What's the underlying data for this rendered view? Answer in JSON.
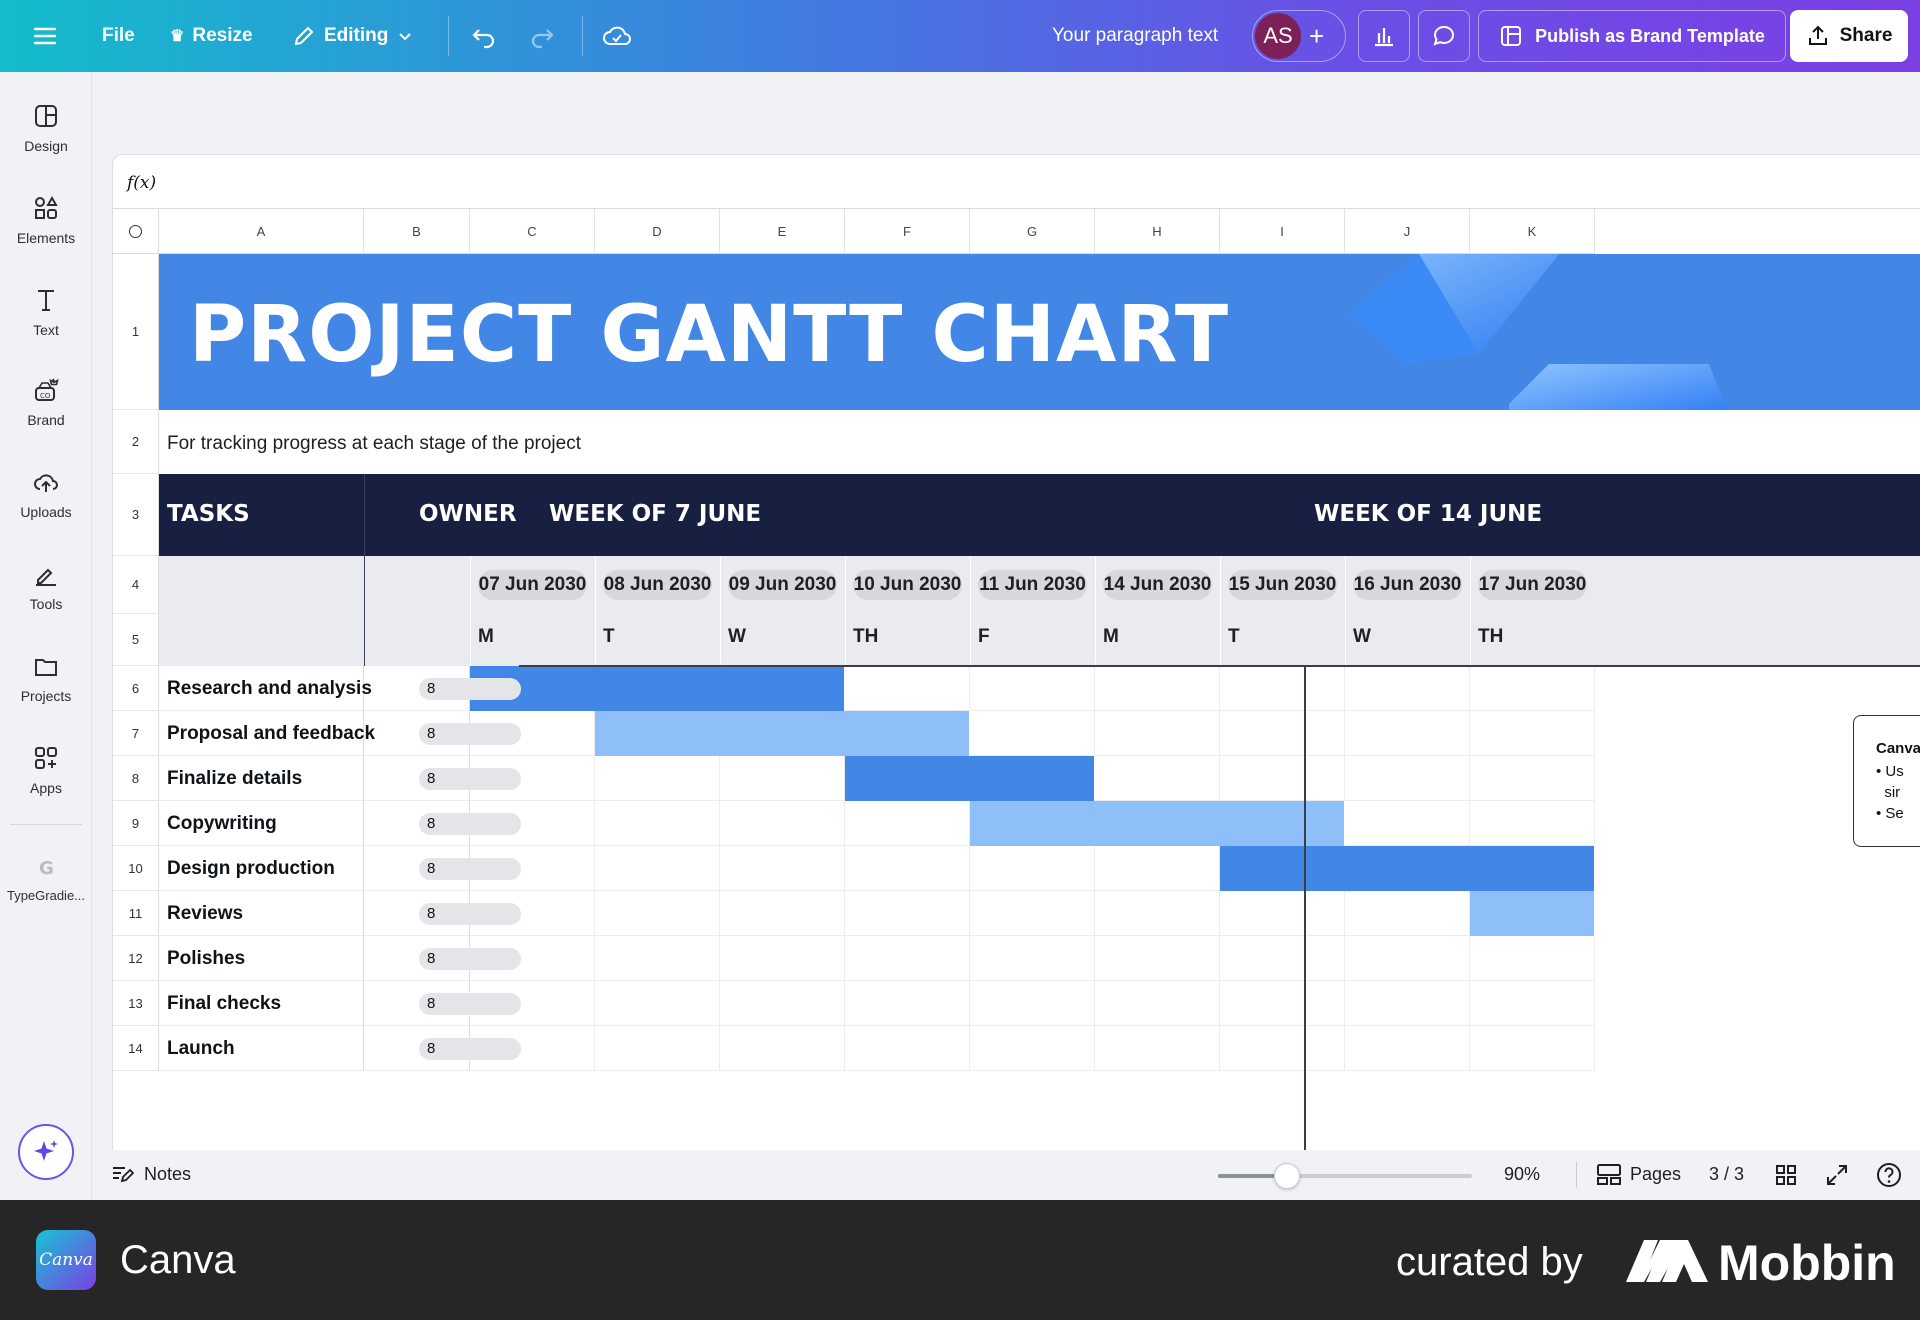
{
  "topbar": {
    "file": "File",
    "resize": "Resize",
    "editing": "Editing",
    "doc_title": "Your paragraph text",
    "avatar": "AS",
    "publish": "Publish as Brand Template",
    "share": "Share"
  },
  "sidebar": [
    {
      "label": "Design",
      "icon": "design-icon"
    },
    {
      "label": "Elements",
      "icon": "elements-icon"
    },
    {
      "label": "Text",
      "icon": "text-icon"
    },
    {
      "label": "Brand",
      "icon": "brand-icon"
    },
    {
      "label": "Uploads",
      "icon": "uploads-icon"
    },
    {
      "label": "Tools",
      "icon": "tools-icon"
    },
    {
      "label": "Projects",
      "icon": "projects-icon"
    },
    {
      "label": "Apps",
      "icon": "apps-icon"
    },
    {
      "label": "TypeGradie...",
      "icon": "typegradient-icon"
    }
  ],
  "sheet": {
    "fx": "f(x)",
    "columns": [
      "A",
      "B",
      "C",
      "D",
      "E",
      "F",
      "G",
      "H",
      "I",
      "J",
      "K"
    ],
    "rows": [
      "1",
      "2",
      "3",
      "4",
      "5",
      "6",
      "7",
      "8",
      "9",
      "10",
      "11",
      "12",
      "13",
      "14"
    ],
    "title": "PROJECT GANTT CHART",
    "subtitle": "For tracking progress at each stage of the project",
    "header_tasks": "TASKS",
    "header_owner": "OWNER",
    "week1": "WEEK OF 7 JUNE",
    "week2": "WEEK OF 14 JUNE",
    "dates": [
      "07 Jun 2030",
      "08 Jun 2030",
      "09 Jun 2030",
      "10 Jun 2030",
      "11 Jun 2030",
      "14 Jun 2030",
      "15 Jun 2030",
      "16 Jun 2030",
      "17 Jun 2030"
    ],
    "days": [
      "M",
      "T",
      "W",
      "TH",
      "F",
      "M",
      "T",
      "W",
      "TH"
    ],
    "owner_glyph": "8",
    "tasks": [
      {
        "name": "Research and analysis",
        "start": 0,
        "span": 3,
        "shade": "dark"
      },
      {
        "name": "Proposal and feedback",
        "start": 1,
        "span": 3,
        "shade": "light"
      },
      {
        "name": "Finalize details",
        "start": 3,
        "span": 2,
        "shade": "dark"
      },
      {
        "name": "Copywriting",
        "start": 4,
        "span": 3,
        "shade": "light"
      },
      {
        "name": "Design production",
        "start": 6,
        "span": 3,
        "shade": "dark"
      },
      {
        "name": "Reviews",
        "start": 8,
        "span": 1,
        "shade": "light"
      },
      {
        "name": "Polishes",
        "start": -1,
        "span": 0,
        "shade": "none"
      },
      {
        "name": "Final checks",
        "start": -1,
        "span": 0,
        "shade": "none"
      },
      {
        "name": "Launch",
        "start": -1,
        "span": 0,
        "shade": "none"
      }
    ],
    "tooltip": {
      "title": "Canva",
      "lines": [
        "Us",
        "sir",
        "Se"
      ]
    }
  },
  "bottom": {
    "notes": "Notes",
    "zoom_level": 0.27,
    "zoom": "90%",
    "pages": "Pages",
    "page_count": "3 / 3"
  },
  "footer": {
    "app": "Canva",
    "logo_text": "Canva",
    "curated": "curated by",
    "brand": "Mobbin"
  },
  "colors": {
    "bar_dark": "#4287e6",
    "bar_light": "#8fbff8",
    "header_dark": "#172040"
  }
}
